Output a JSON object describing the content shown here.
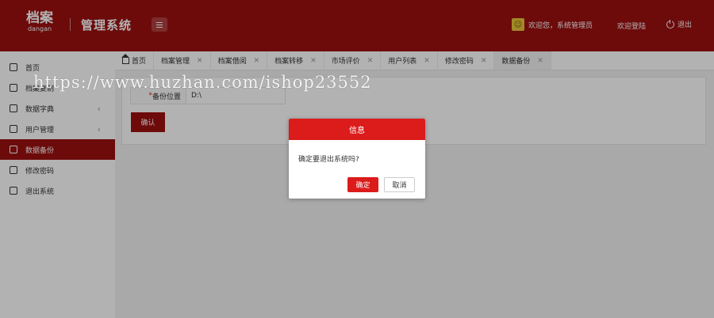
{
  "header": {
    "logo_main": "档案",
    "logo_sub": "dangan",
    "app_title": "管理系统",
    "greeting": "欢迎您，系统管理员",
    "welcome_link": "欢迎登陆",
    "logout": "退出"
  },
  "sidebar": {
    "items": [
      {
        "label": "首页",
        "icon": "monitor-icon",
        "has_arrow": false
      },
      {
        "label": "档案复制",
        "icon": "user-file-icon",
        "has_arrow": false
      },
      {
        "label": "数据字典",
        "icon": "tag-icon",
        "has_arrow": true
      },
      {
        "label": "用户管理",
        "icon": "user-icon",
        "has_arrow": true
      },
      {
        "label": "数据备份",
        "icon": "backup-icon",
        "has_arrow": false,
        "active": true
      },
      {
        "label": "修改密码",
        "icon": "key-icon",
        "has_arrow": false
      },
      {
        "label": "退出系统",
        "icon": "exit-icon",
        "has_arrow": false
      }
    ]
  },
  "tabs": [
    {
      "label": "首页",
      "closable": false
    },
    {
      "label": "档案管理",
      "closable": true
    },
    {
      "label": "档案借阅",
      "closable": true
    },
    {
      "label": "档案转移",
      "closable": true
    },
    {
      "label": "市场评价",
      "closable": true
    },
    {
      "label": "用户列表",
      "closable": true
    },
    {
      "label": "修改密码",
      "closable": true
    },
    {
      "label": "数据备份",
      "closable": true,
      "active": true
    }
  ],
  "form": {
    "backup_location_label": "备份位置",
    "backup_location_value": "D:\\",
    "confirm_button": "确认"
  },
  "watermark": "https://www.huzhan.com/ishop23552",
  "dialog": {
    "title": "信息",
    "message": "确定要退出系统吗?",
    "ok_label": "确定",
    "cancel_label": "取消"
  },
  "colors": {
    "brand_dark_red": "#9d1010",
    "dialog_red": "#dc1b1b"
  }
}
